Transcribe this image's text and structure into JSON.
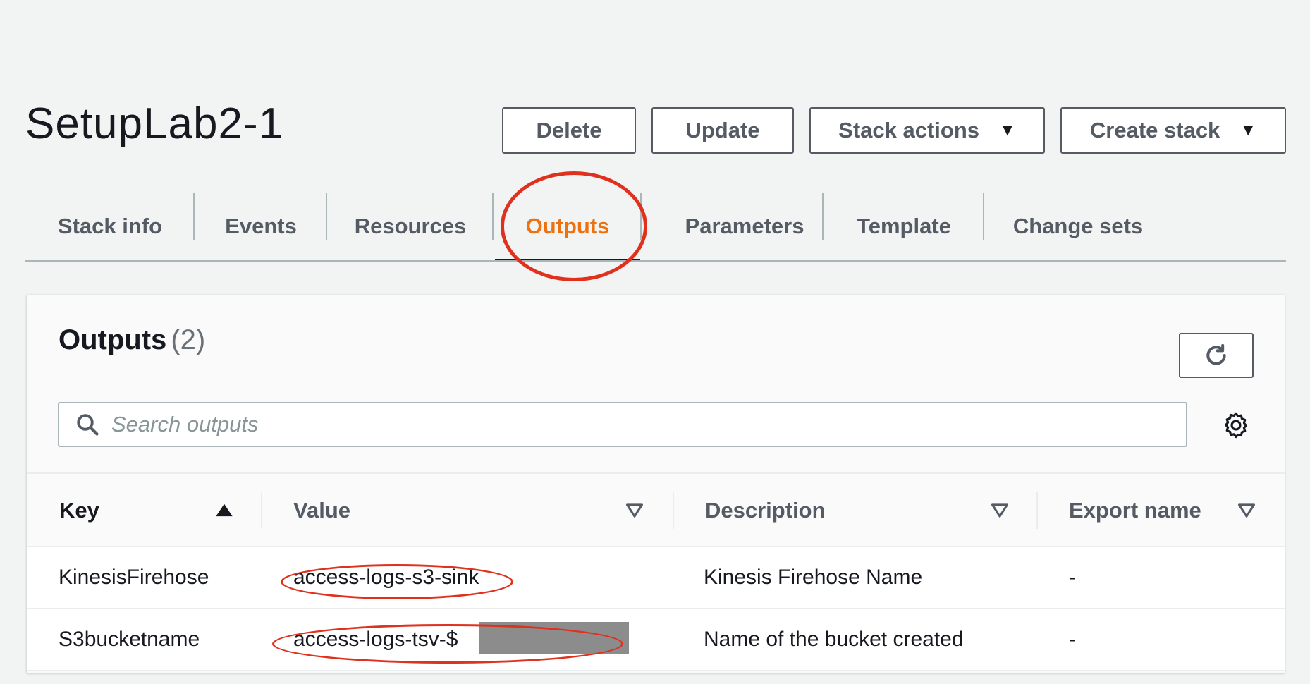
{
  "stack": {
    "title": "SetupLab2-1"
  },
  "actions": {
    "delete": "Delete",
    "update": "Update",
    "stack_actions": "Stack actions",
    "create_stack": "Create stack",
    "caret": "▼"
  },
  "tabs": [
    {
      "label": "Stack info"
    },
    {
      "label": "Events"
    },
    {
      "label": "Resources"
    },
    {
      "label": "Outputs",
      "active": true
    },
    {
      "label": "Parameters"
    },
    {
      "label": "Template"
    },
    {
      "label": "Change sets"
    }
  ],
  "outputs": {
    "heading": "Outputs",
    "count": "(2)",
    "search_placeholder": "Search outputs",
    "columns": {
      "key": "Key",
      "value": "Value",
      "description": "Description",
      "export_name": "Export name"
    },
    "rows": [
      {
        "key": "KinesisFirehose",
        "value": "access-logs-s3-sink",
        "description": "Kinesis Firehose Name",
        "export_name": "-"
      },
      {
        "key": "S3bucketname",
        "value": "access-logs-tsv-$",
        "description": "Name of the bucket created",
        "export_name": "-"
      }
    ]
  },
  "colors": {
    "accent": "#ec7211",
    "annotation": "#e0301e",
    "text": "#16191f",
    "muted": "#545b64"
  },
  "icons": {
    "search": "search-icon",
    "refresh": "refresh-icon",
    "settings": "gear-icon",
    "sort_asc": "sort-ascending-icon",
    "sort_desc": "sort-descending-icon",
    "dropdown": "caret-down-icon"
  }
}
